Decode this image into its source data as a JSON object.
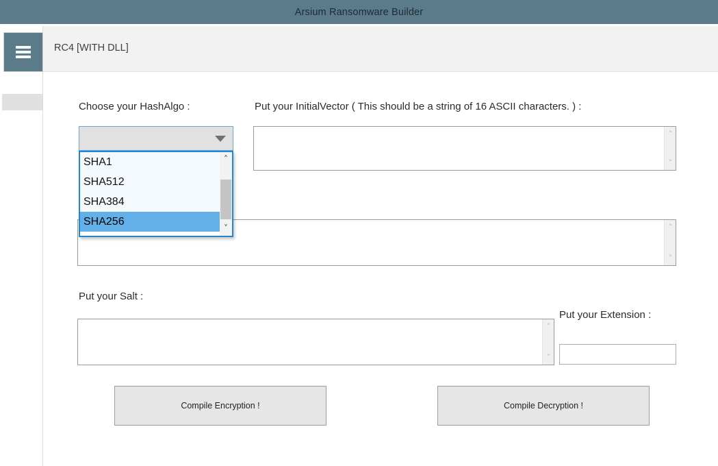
{
  "window": {
    "title": "Arsium Ransomware Builder",
    "titlebar_color": "#5b7b8b"
  },
  "header": {
    "menu_icon": "hamburger-menu-icon",
    "page_title": "RC4 [WITH DLL]"
  },
  "sidebar": {
    "items": [
      {
        "label": "",
        "name": "sidebar-placeholder-slot"
      }
    ]
  },
  "form": {
    "hash_algo": {
      "label": "Choose your HashAlgo :",
      "selected_value": "",
      "options": [
        "SHA1",
        "SHA512",
        "SHA384",
        "SHA256"
      ],
      "highlighted_option": "SHA256",
      "expanded": true
    },
    "initial_vector": {
      "label": "Put your InitialVector ( This should be a string of 16 ASCII characters. ) :",
      "value": "",
      "placeholder": ""
    },
    "second_field": {
      "label": "",
      "value": "",
      "placeholder": ""
    },
    "salt": {
      "label": "Put your Salt :",
      "value": "",
      "placeholder": ""
    },
    "extension": {
      "label": "Put your Extension :",
      "value": "",
      "placeholder": ""
    }
  },
  "actions": {
    "compile_encryption": "Compile Encryption !",
    "compile_decryption": "Compile Decryption !"
  },
  "icons": {
    "scroll_up": "˄",
    "scroll_down": "˅",
    "list_scroll_up": "˄",
    "list_scroll_down": "˅"
  }
}
